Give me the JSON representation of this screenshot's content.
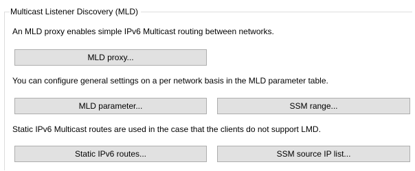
{
  "group": {
    "title": "Multicast Listener Discovery (MLD)"
  },
  "sections": {
    "proxy": {
      "description": "An MLD proxy enables simple IPv6 Multicast routing between networks.",
      "button": "MLD proxy..."
    },
    "parameters": {
      "description": "You can configure general settings on a per network basis in the MLD parameter table.",
      "button_left": "MLD parameter...",
      "button_right": "SSM range..."
    },
    "routes": {
      "description": "Static IPv6 Multicast routes are used in the case that the clients do not support LMD.",
      "button_left": "Static IPv6 routes...",
      "button_right": "SSM source IP list..."
    }
  },
  "colors": {
    "button_face": "#e1e1e1",
    "button_border": "#adadad",
    "group_border": "#dcdcdc"
  }
}
